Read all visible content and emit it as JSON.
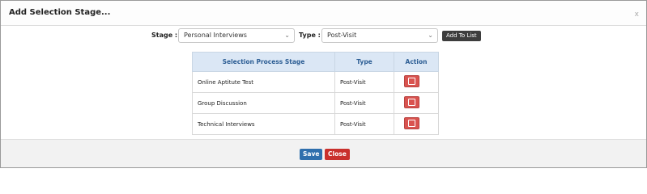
{
  "dialog": {
    "title": "Add Selection Stage...",
    "close_label": "x"
  },
  "form": {
    "stage_label": "Stage :",
    "stage_value": "Personal Interviews",
    "type_label": "Type :",
    "type_value": "Post-Visit",
    "add_button": "Add To List"
  },
  "table": {
    "headers": [
      "Selection Process Stage",
      "Type",
      "Action"
    ],
    "rows": [
      {
        "stage": "Online Aptitute Test",
        "type": "Post-Visit"
      },
      {
        "stage": "Group Discussion",
        "type": "Post-Visit"
      },
      {
        "stage": "Technical Interviews",
        "type": "Post-Visit"
      }
    ]
  },
  "footer": {
    "save": "Save",
    "close": "Close"
  },
  "colors": {
    "header_bg": "#dbe7f5",
    "header_text": "#2e5f95",
    "delete": "#d9534f",
    "save": "#2f6fad",
    "close": "#c9302c"
  }
}
